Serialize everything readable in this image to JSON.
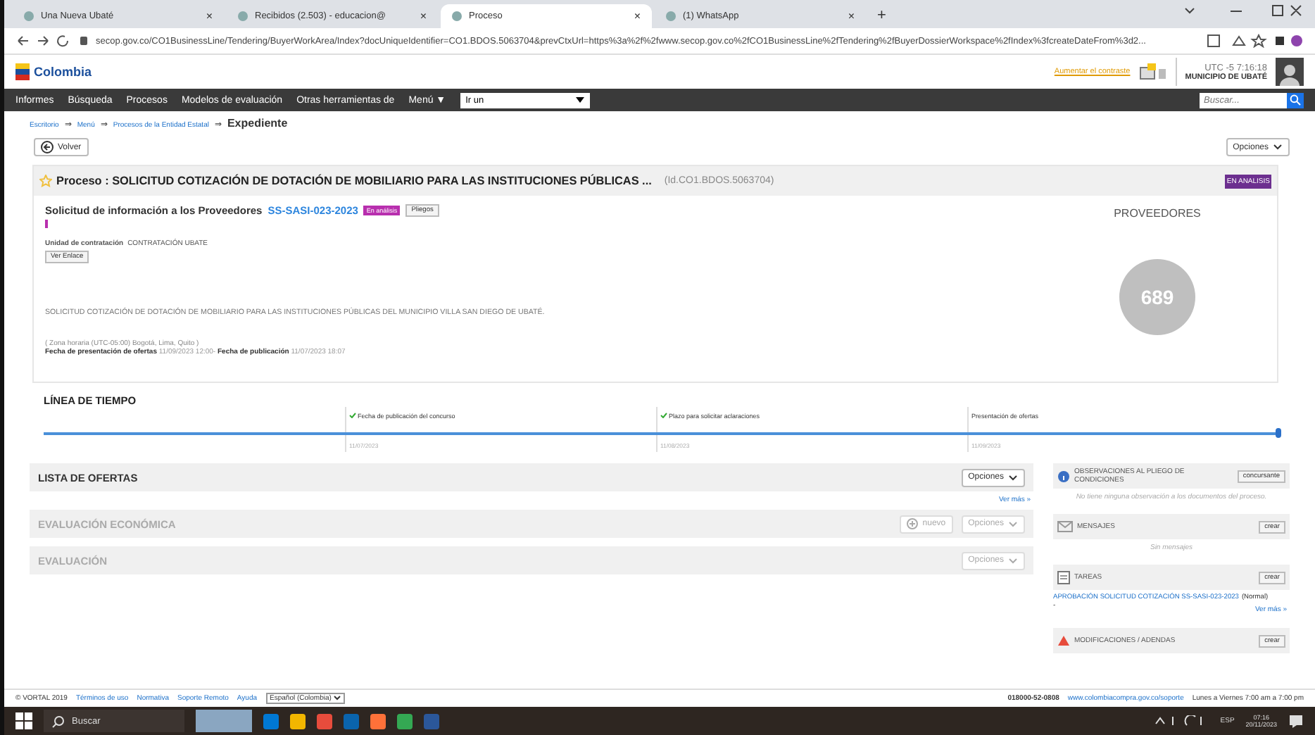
{
  "browser": {
    "tabs": [
      {
        "title": "Una Nueva Ubaté",
        "selected": false,
        "close": "×"
      },
      {
        "title": "Recibidos (2.503) - educacion@",
        "selected": false,
        "close": "×"
      },
      {
        "title": "Proceso",
        "selected": true,
        "close": "×"
      },
      {
        "title": "(1) WhatsApp",
        "selected": false,
        "close": "×"
      }
    ],
    "new_tab": "+",
    "url": "secop.gov.co/CO1BusinessLine/Tendering/BuyerWorkArea/Index?docUniqueIdentifier=CO1.BDOS.5063704&prevCtxUrl=https%3a%2f%2fwww.secop.gov.co%2fCO1BusinessLine%2fTendering%2fBuyerDossierWorkspace%2fIndex%3fcreateDateFrom%3d2..."
  },
  "header": {
    "logo": "Colombia",
    "contrast_link": "Aumentar el contraste",
    "time": "UTC -5 7:16:18",
    "entity": "MUNICIPIO DE UBATÉ"
  },
  "nav": {
    "items": [
      "Informes",
      "Búsqueda",
      "Procesos",
      "Modelos de evaluación",
      "Otras herramientas de",
      "Menú ▼"
    ],
    "goto": "Ir un",
    "search_placeholder": "Buscar..."
  },
  "breadcrumb": {
    "links": [
      "Escritorio",
      "Menú",
      "Procesos de la Entidad Estatal"
    ],
    "separator": "⇒",
    "current": "Expediente"
  },
  "back_button": "Volver",
  "options_button": "Opciones",
  "process": {
    "title": "Proceso : SOLICITUD COTIZACIÓN DE DOTACIÓN DE MOBILIARIO PARA LAS INSTITUCIONES PÚBLICAS ...",
    "id": "(Id.CO1.BDOS.5063704)",
    "status": "EN ANALISIS",
    "subtitle": "Solicitud de información a los Proveedores",
    "code": "SS-SASI-023-2023",
    "badge": "En análisis",
    "pliegos": "Pliegos",
    "unit_label": "Unidad de contratación",
    "unit": "CONTRATACIÓN UBATE",
    "link_button": "Ver Enlace",
    "description": "SOLICITUD COTIZACIÓN DE DOTACIÓN DE MOBILIARIO PARA LAS INSTITUCIONES PÚBLICAS DEL MUNICIPIO VILLA SAN DIEGO DE UBATÉ.",
    "timezone": "( Zona horaria  (UTC-05:00) Bogotá, Lima, Quito )",
    "dates": "**Fecha de presentación de ofertas** 11/09/2023 12:00- **Fecha de publicación** 11/07/2023 18:07",
    "providers_label": "PROVEEDORES",
    "providers": "689"
  },
  "timeline": {
    "title": "LÍNEA DE TIEMPO",
    "milestones": [
      {
        "label": "Fecha de publicación del concurso",
        "date": "11/07/2023",
        "done": true
      },
      {
        "label": "Plazo para solicitar aclaraciones",
        "date": "11/08/2023",
        "done": true
      },
      {
        "label": "Presentación de ofertas",
        "date": "11/09/2023",
        "done": false
      }
    ]
  },
  "sections": [
    {
      "title": "LISTA DE OFERTAS",
      "disabled": false,
      "options": "Opciones",
      "more": "Ver más »"
    },
    {
      "title": "EVALUACIÓN ECONÓMICA",
      "disabled": true,
      "new": "nuevo",
      "options": "Opciones"
    },
    {
      "title": "EVALUACIÓN",
      "disabled": true,
      "options": "Opciones"
    }
  ],
  "side_cards": [
    {
      "kind": "info",
      "title": "OBSERVACIONES AL PLIEGO DE CONDICIONES",
      "button": "concursante",
      "text": "No tiene ninguna observación a los documentos del proceso."
    },
    {
      "kind": "mail",
      "title": "MENSAJES",
      "button": "crear",
      "text": "Sin mensajes"
    },
    {
      "kind": "task",
      "title": "TAREAS",
      "button": "crear",
      "link": "APROBACIÓN SOLICITUD COTIZACIÓN SS-SASI-023-2023",
      "note": "(Normal)",
      "dash": "-",
      "more": "Ver más »"
    },
    {
      "kind": "warn",
      "title": "MODIFICACIONES / ADENDAS",
      "button": "crear"
    }
  ],
  "footer": {
    "copyright": "© VORTAL 2019",
    "links": [
      "Términos de uso",
      "Normativa",
      "Soporte Remoto",
      "Ayuda"
    ],
    "language": "Español (Colombia)",
    "phone": "018000-52-0808",
    "site": "www.colombiacompra.gov.co/soporte",
    "hours": "Lunes a Viernes 7:00 am a 7:00 pm"
  },
  "taskbar": {
    "search": "Buscar",
    "lang": "ESP",
    "time": "07:16",
    "date": "20/11/2023"
  }
}
